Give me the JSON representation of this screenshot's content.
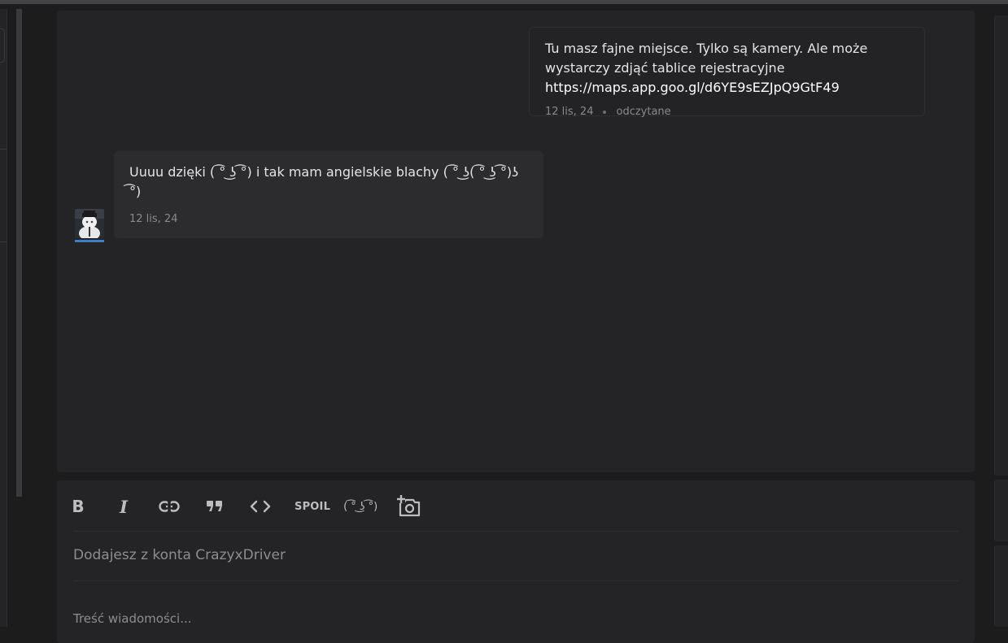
{
  "chat": {
    "messages": [
      {
        "direction": "outgoing",
        "text": "Tu masz fajne miejsce. Tylko są kamery. Ale może wystarczy zdjąć tablice rejestracyjne",
        "link": "https://maps.app.goo.gl/d6YE9sEZJpQ9GtF49",
        "date": "12 lis, 24",
        "status": "odczytane"
      },
      {
        "direction": "incoming",
        "text": "Uuuu dzięki ( ͡° ͜ʖ ͡°) i tak mam angielskie blachy ( ͡° ͜ʖ( ͡° ͜ʖ ͡°)ʖ ͡°)",
        "date": "12 lis, 24"
      }
    ]
  },
  "composer": {
    "toolbar": {
      "bold_icon": "bold-icon",
      "italic_icon": "italic-icon",
      "link_icon": "link-icon",
      "quote_icon": "quote-icon",
      "code_icon": "code-icon",
      "spoil_label": "SPOIL",
      "lenny_label": "( ͡° ͜ʖ ͡°)",
      "photo_icon": "add-photo-icon"
    },
    "account_text": "Dodajesz z konta CrazyxDriver",
    "message_placeholder": "Treść wiadomości..."
  },
  "colors": {
    "page_background": "#1c1c1d",
    "panel_background": "#242426",
    "incoming_bubble": "#2c2c2e",
    "avatar_underline": "#3b7fc4"
  }
}
